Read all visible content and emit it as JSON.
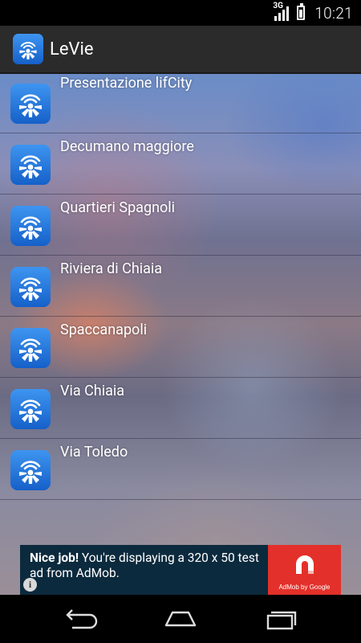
{
  "status_bar": {
    "network_type": "3G",
    "time": "10:21"
  },
  "app": {
    "title": "LeVie",
    "icon": "levie-app-icon"
  },
  "list": {
    "items": [
      {
        "label": "Presentazione lifCity",
        "icon": "levie-app-icon"
      },
      {
        "label": "Decumano maggiore",
        "icon": "levie-app-icon"
      },
      {
        "label": "Quartieri Spagnoli",
        "icon": "levie-app-icon"
      },
      {
        "label": "Riviera di Chiaia",
        "icon": "levie-app-icon"
      },
      {
        "label": "Spaccanapoli",
        "icon": "levie-app-icon"
      },
      {
        "label": "Via Chiaia",
        "icon": "levie-app-icon"
      },
      {
        "label": "Via Toledo",
        "icon": "levie-app-icon"
      }
    ]
  },
  "ad": {
    "headline": "Nice job!",
    "body": "You're displaying a 320 x 50 test ad from AdMob.",
    "brand": "AdMob by Google",
    "info_glyph": "i"
  },
  "nav": {
    "back": "back-icon",
    "home": "home-icon",
    "recents": "recents-icon"
  },
  "colors": {
    "action_bar": "#2b2b2b",
    "ad_background": "#0c2a3d",
    "ad_brand": "#e3302a",
    "icon_blue": "#1f73d9"
  }
}
